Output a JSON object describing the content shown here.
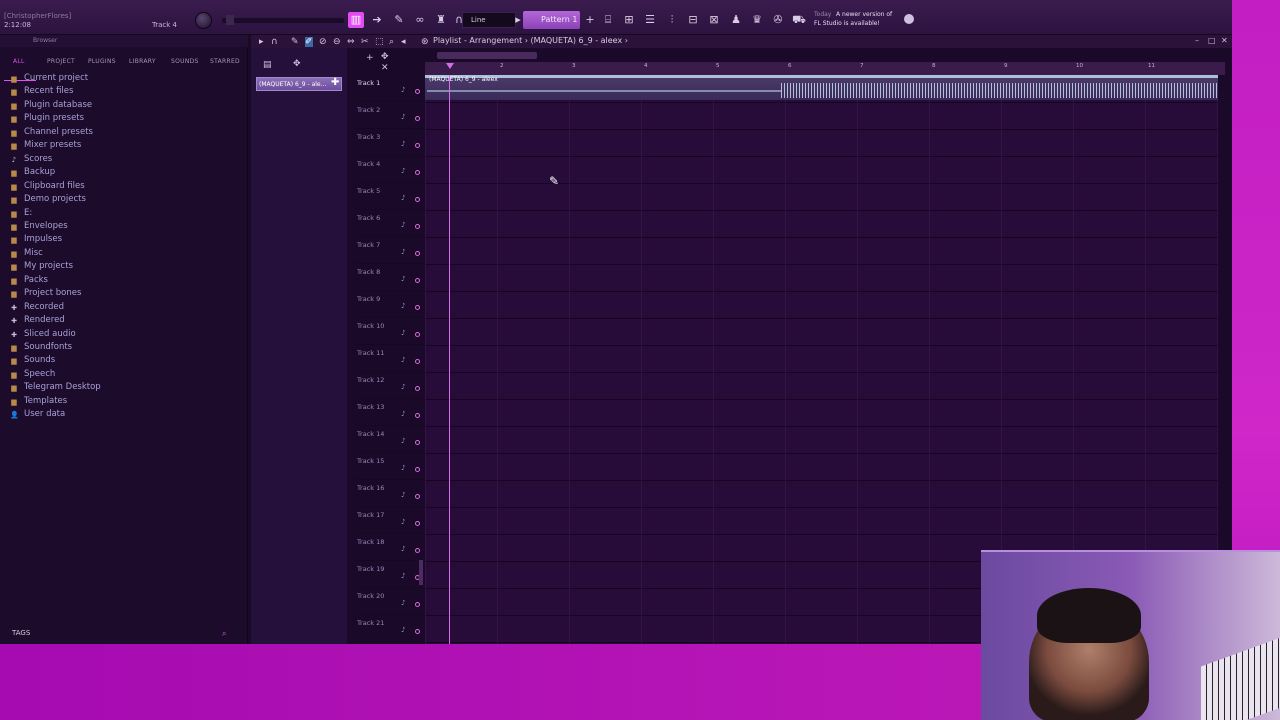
{
  "app": {
    "user": "[ChristopherFlores]",
    "time": "2:12:08",
    "track_indicator": "Track 4",
    "snap_value": "Line",
    "pattern_label": "Pattern 1",
    "news_date": "Today",
    "news_text": "A newer version of",
    "news_text2": "FL Studio is available!"
  },
  "browser": {
    "title": "Browser",
    "tabs": [
      "ALL",
      "PROJECT",
      "PLUGINS",
      "LIBRARY",
      "SOUNDS",
      "STARRED"
    ],
    "items": [
      {
        "label": "Current project",
        "icon": "folder-icon"
      },
      {
        "label": "Recent files",
        "icon": "folder-icon"
      },
      {
        "label": "Plugin database",
        "icon": "folder-icon"
      },
      {
        "label": "Plugin presets",
        "icon": "folder-icon"
      },
      {
        "label": "Channel presets",
        "icon": "folder-icon"
      },
      {
        "label": "Mixer presets",
        "icon": "folder-icon"
      },
      {
        "label": "Scores",
        "icon": "note-icon"
      },
      {
        "label": "Backup",
        "icon": "folder-icon"
      },
      {
        "label": "Clipboard files",
        "icon": "folder-icon"
      },
      {
        "label": "Demo projects",
        "icon": "folder-icon"
      },
      {
        "label": "E:",
        "icon": "folder-icon"
      },
      {
        "label": "Envelopes",
        "icon": "folder-icon"
      },
      {
        "label": "Impulses",
        "icon": "folder-icon"
      },
      {
        "label": "Misc",
        "icon": "folder-icon"
      },
      {
        "label": "My projects",
        "icon": "folder-icon"
      },
      {
        "label": "Packs",
        "icon": "folder-icon"
      },
      {
        "label": "Project bones",
        "icon": "folder-icon"
      },
      {
        "label": "Recorded",
        "icon": "plus-icon"
      },
      {
        "label": "Rendered",
        "icon": "plus-icon"
      },
      {
        "label": "Sliced audio",
        "icon": "plus-icon"
      },
      {
        "label": "Soundfonts",
        "icon": "folder-icon"
      },
      {
        "label": "Sounds",
        "icon": "folder-icon"
      },
      {
        "label": "Speech",
        "icon": "folder-icon"
      },
      {
        "label": "Telegram Desktop",
        "icon": "folder-icon"
      },
      {
        "label": "Templates",
        "icon": "folder-icon"
      },
      {
        "label": "User data",
        "icon": "user-icon"
      }
    ],
    "tags_label": "TAGS"
  },
  "playlist": {
    "title": "Playlist - Arrangement",
    "project": "(MAQUETA) 6_9 - aleex",
    "pattern_item": "(MAQUETA) 6_9 - ale...",
    "clip_label": "(MAQUETA) 6_9 - aleex",
    "ruler_ticks": [
      "2",
      "3",
      "4",
      "5",
      "6",
      "7",
      "8",
      "9",
      "10",
      "11"
    ],
    "tracks": [
      "Track 1",
      "Track 2",
      "Track 3",
      "Track 4",
      "Track 5",
      "Track 6",
      "Track 7",
      "Track 8",
      "Track 9",
      "Track 10",
      "Track 11",
      "Track 12",
      "Track 13",
      "Track 14",
      "Track 15",
      "Track 16",
      "Track 17",
      "Track 18",
      "Track 19",
      "Track 20",
      "Track 21"
    ]
  },
  "colors": {
    "accent": "#e84ef6",
    "background": "#1a0a26",
    "backdrop": "#c21ec3"
  }
}
